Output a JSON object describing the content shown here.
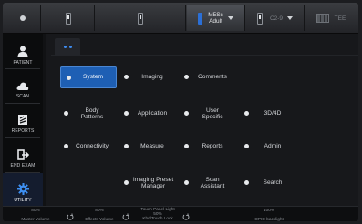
{
  "topbar": {
    "probe_name": "M5Sc",
    "preset": "Adult",
    "probe2": "C2-9",
    "probe3": "TEE"
  },
  "sidebar": {
    "items": [
      {
        "label": "PATIENT",
        "icon": "patient-icon"
      },
      {
        "label": "SCAN",
        "icon": "scan-icon"
      },
      {
        "label": "REPORTS",
        "icon": "reports-icon"
      },
      {
        "label": "END EXAM",
        "icon": "end-exam-icon"
      },
      {
        "label": "UTILITY",
        "icon": "gear-icon"
      }
    ]
  },
  "buttons": {
    "system": "System",
    "imaging": "Imaging",
    "comments": "Comments",
    "body_patterns": "Body Patterns",
    "application": "Application",
    "user_specific": "User Specific",
    "three_d_ad": "3D/4D",
    "connectivity": "Connectivity",
    "measure": "Measure",
    "reports": "Reports",
    "admin": "Admin",
    "imaging_preset_manager": "Imaging Preset Manager",
    "scan_assistant": "Scan Assistant",
    "search": "Search"
  },
  "bottombar": {
    "master_volume_value": "80%",
    "master_volume_label": "Master Volume",
    "effects_volume_value": "80%",
    "effects_volume_label": "Effects Volume",
    "touch_panel_value_1": "Touch Panel Light",
    "touch_panel_value_2": "50%",
    "touch_panel_label": "Kbd/Touch Lock",
    "opio_value": "100%",
    "opio_label": "OPIO backlight"
  },
  "colors": {
    "accent": "#1e5fb4",
    "background": "#17181b"
  }
}
